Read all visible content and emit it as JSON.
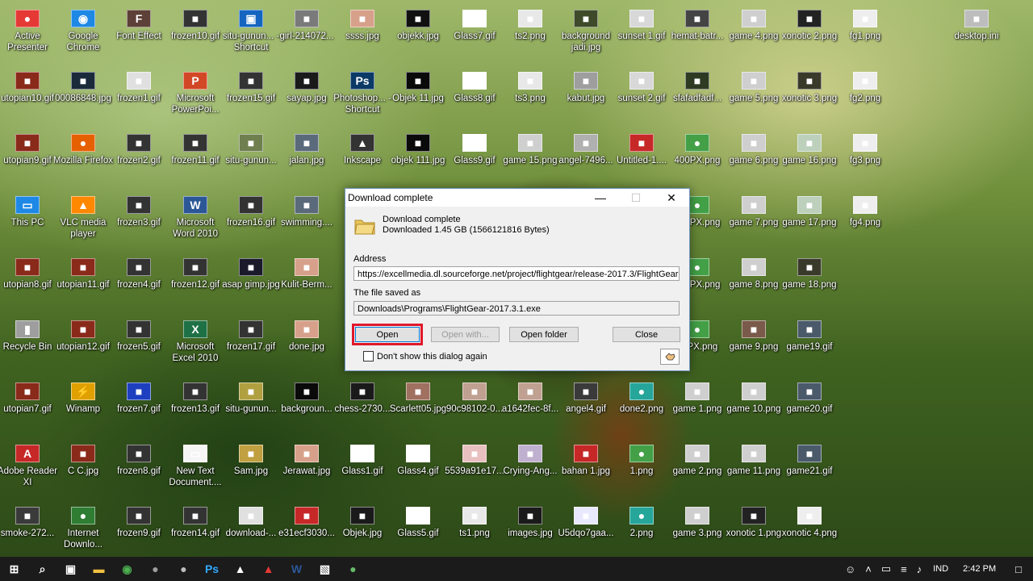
{
  "desktop_icons": [
    {
      "label": "Active Presenter",
      "glyph": "●",
      "color": "#e53935",
      "col": 0,
      "row": 0
    },
    {
      "label": "Google Chrome",
      "glyph": "◉",
      "color": "#1e88e5",
      "col": 1,
      "row": 0
    },
    {
      "label": "Font Effect",
      "glyph": "F",
      "color": "#5d4037",
      "col": 2,
      "row": 0
    },
    {
      "label": "frozen10.gif",
      "glyph": "■",
      "color": "#333333",
      "col": 3,
      "row": 0
    },
    {
      "label": "situ-gunun... - Shortcut",
      "glyph": "▣",
      "color": "#1565c0",
      "col": 4,
      "row": 0
    },
    {
      "label": "girl-214072...",
      "glyph": "■",
      "color": "#7a7a7a",
      "col": 5,
      "row": 0
    },
    {
      "label": "ssss.jpg",
      "glyph": "■",
      "color": "#d7a08a",
      "col": 6,
      "row": 0
    },
    {
      "label": "objekk.jpg",
      "glyph": "■",
      "color": "#111111",
      "col": 7,
      "row": 0
    },
    {
      "label": "Glass7.gif",
      "glyph": "■",
      "color": "#ffffff",
      "col": 8,
      "row": 0
    },
    {
      "label": "ts2.png",
      "glyph": "■",
      "color": "#e8e8e8",
      "col": 9,
      "row": 0
    },
    {
      "label": "background jadi.jpg",
      "glyph": "■",
      "color": "#3e4a2a",
      "col": 10,
      "row": 0
    },
    {
      "label": "sunset 1.gif",
      "glyph": "■",
      "color": "#d8d8d8",
      "col": 11,
      "row": 0
    },
    {
      "label": "hemat-batr...",
      "glyph": "■",
      "color": "#444444",
      "col": 12,
      "row": 0
    },
    {
      "label": "game 4.png",
      "glyph": "■",
      "color": "#cfcfcf",
      "col": 13,
      "row": 0
    },
    {
      "label": "xonotic 2.png",
      "glyph": "■",
      "color": "#222222",
      "col": 14,
      "row": 0
    },
    {
      "label": "fg1.png",
      "glyph": "■",
      "color": "#eeeeee",
      "col": 15,
      "row": 0
    },
    {
      "label": "desktop.ini",
      "glyph": "■",
      "color": "#bdbdbd",
      "col": 17,
      "row": 0
    },
    {
      "label": "utopian10.gif",
      "glyph": "■",
      "color": "#8a2a1a",
      "col": 0,
      "row": 1
    },
    {
      "label": "00086848.jpg",
      "glyph": "■",
      "color": "#1a2a3a",
      "col": 1,
      "row": 1
    },
    {
      "label": "frozen1.gif",
      "glyph": "■",
      "color": "#e0e0e0",
      "col": 2,
      "row": 1
    },
    {
      "label": "Microsoft PowerPoi...",
      "glyph": "P",
      "color": "#d24726",
      "col": 3,
      "row": 1
    },
    {
      "label": "frozen15.gif",
      "glyph": "■",
      "color": "#333333",
      "col": 4,
      "row": 1
    },
    {
      "label": "sayap.jpg",
      "glyph": "■",
      "color": "#1a1a1a",
      "col": 5,
      "row": 1
    },
    {
      "label": "Photoshop... - Shortcut",
      "glyph": "Ps",
      "color": "#0b3a66",
      "col": 6,
      "row": 1
    },
    {
      "label": "Objek 11.jpg",
      "glyph": "■",
      "color": "#0a0a0a",
      "col": 7,
      "row": 1
    },
    {
      "label": "Glass8.gif",
      "glyph": "■",
      "color": "#ffffff",
      "col": 8,
      "row": 1
    },
    {
      "label": "ts3.png",
      "glyph": "■",
      "color": "#e8e8e8",
      "col": 9,
      "row": 1
    },
    {
      "label": "kabut.jpg",
      "glyph": "■",
      "color": "#9e9e9e",
      "col": 10,
      "row": 1
    },
    {
      "label": "sunset 2.gif",
      "glyph": "■",
      "color": "#d8d8d8",
      "col": 11,
      "row": 1
    },
    {
      "label": "sfafadfadf...",
      "glyph": "■",
      "color": "#2e3b22",
      "col": 12,
      "row": 1
    },
    {
      "label": "game 5.png",
      "glyph": "■",
      "color": "#cfcfcf",
      "col": 13,
      "row": 1
    },
    {
      "label": "xonotic 3.png",
      "glyph": "■",
      "color": "#3a3a2a",
      "col": 14,
      "row": 1
    },
    {
      "label": "fg2.png",
      "glyph": "■",
      "color": "#eeeeee",
      "col": 15,
      "row": 1
    },
    {
      "label": "utopian9.gif",
      "glyph": "■",
      "color": "#8a2a1a",
      "col": 0,
      "row": 2
    },
    {
      "label": "Mozilla Firefox",
      "glyph": "●",
      "color": "#e66000",
      "col": 1,
      "row": 2
    },
    {
      "label": "frozen2.gif",
      "glyph": "■",
      "color": "#333333",
      "col": 2,
      "row": 2
    },
    {
      "label": "frozen11.gif",
      "glyph": "■",
      "color": "#333333",
      "col": 3,
      "row": 2
    },
    {
      "label": "situ-gunun...",
      "glyph": "■",
      "color": "#6f7f4f",
      "col": 4,
      "row": 2
    },
    {
      "label": "jalan.jpg",
      "glyph": "■",
      "color": "#5a6a7a",
      "col": 5,
      "row": 2
    },
    {
      "label": "Inkscape",
      "glyph": "▲",
      "color": "#333333",
      "col": 6,
      "row": 2
    },
    {
      "label": "objek 111.jpg",
      "glyph": "■",
      "color": "#0a0a0a",
      "col": 7,
      "row": 2
    },
    {
      "label": "Glass9.gif",
      "glyph": "■",
      "color": "#ffffff",
      "col": 8,
      "row": 2
    },
    {
      "label": "game 15.png",
      "glyph": "■",
      "color": "#cfcfcf",
      "col": 9,
      "row": 2
    },
    {
      "label": "angel-7496...",
      "glyph": "■",
      "color": "#b0b0b0",
      "col": 10,
      "row": 2
    },
    {
      "label": "Untitled-1....",
      "glyph": "■",
      "color": "#c62828",
      "col": 11,
      "row": 2
    },
    {
      "label": "400PX.png",
      "glyph": "●",
      "color": "#43a047",
      "col": 12,
      "row": 2
    },
    {
      "label": "game 6.png",
      "glyph": "■",
      "color": "#cfcfcf",
      "col": 13,
      "row": 2
    },
    {
      "label": "game 16.png",
      "glyph": "■",
      "color": "#bcd0bc",
      "col": 14,
      "row": 2
    },
    {
      "label": "fg3.png",
      "glyph": "■",
      "color": "#eeeeee",
      "col": 15,
      "row": 2
    },
    {
      "label": "This PC",
      "glyph": "▭",
      "color": "#1e88e5",
      "col": 0,
      "row": 3
    },
    {
      "label": "VLC media player",
      "glyph": "▲",
      "color": "#ff8800",
      "col": 1,
      "row": 3
    },
    {
      "label": "frozen3.gif",
      "glyph": "■",
      "color": "#333333",
      "col": 2,
      "row": 3
    },
    {
      "label": "Microsoft Word 2010",
      "glyph": "W",
      "color": "#2b5797",
      "col": 3,
      "row": 3
    },
    {
      "label": "frozen16.gif",
      "glyph": "■",
      "color": "#333333",
      "col": 4,
      "row": 3
    },
    {
      "label": "swimming....",
      "glyph": "■",
      "color": "#5a6a7a",
      "col": 5,
      "row": 3
    },
    {
      "label": "200PX.png",
      "glyph": "●",
      "color": "#43a047",
      "col": 12,
      "row": 3
    },
    {
      "label": "game 7.png",
      "glyph": "■",
      "color": "#cfcfcf",
      "col": 13,
      "row": 3
    },
    {
      "label": "game 17.png",
      "glyph": "■",
      "color": "#bcd0bc",
      "col": 14,
      "row": 3
    },
    {
      "label": "fg4.png",
      "glyph": "■",
      "color": "#eeeeee",
      "col": 15,
      "row": 3
    },
    {
      "label": "utopian8.gif",
      "glyph": "■",
      "color": "#8a2a1a",
      "col": 0,
      "row": 4
    },
    {
      "label": "utopian11.gif",
      "glyph": "■",
      "color": "#8a2a1a",
      "col": 1,
      "row": 4
    },
    {
      "label": "frozen4.gif",
      "glyph": "■",
      "color": "#333333",
      "col": 2,
      "row": 4
    },
    {
      "label": "frozen12.gif",
      "glyph": "■",
      "color": "#333333",
      "col": 3,
      "row": 4
    },
    {
      "label": "asap gimp.jpg",
      "glyph": "■",
      "color": "#1a1a2a",
      "col": 4,
      "row": 4
    },
    {
      "label": "Kulit-Berm...",
      "glyph": "■",
      "color": "#d7a08a",
      "col": 5,
      "row": 4
    },
    {
      "label": "144PX.png",
      "glyph": "●",
      "color": "#43a047",
      "col": 12,
      "row": 4
    },
    {
      "label": "game 8.png",
      "glyph": "■",
      "color": "#cfcfcf",
      "col": 13,
      "row": 4
    },
    {
      "label": "game 18.png",
      "glyph": "■",
      "color": "#3a3a2a",
      "col": 14,
      "row": 4
    },
    {
      "label": "Recycle Bin",
      "glyph": "▮",
      "color": "#9e9e9e",
      "col": 0,
      "row": 5
    },
    {
      "label": "utopian12.gif",
      "glyph": "■",
      "color": "#8a2a1a",
      "col": 1,
      "row": 5
    },
    {
      "label": "frozen5.gif",
      "glyph": "■",
      "color": "#333333",
      "col": 2,
      "row": 5
    },
    {
      "label": "Microsoft Excel 2010",
      "glyph": "X",
      "color": "#1e7145",
      "col": 3,
      "row": 5
    },
    {
      "label": "frozen17.gif",
      "glyph": "■",
      "color": "#333333",
      "col": 4,
      "row": 5
    },
    {
      "label": "done.jpg",
      "glyph": "■",
      "color": "#d7a08a",
      "col": 5,
      "row": 5
    },
    {
      "label": "72PX.png",
      "glyph": "●",
      "color": "#43a047",
      "col": 12,
      "row": 5
    },
    {
      "label": "game 9.png",
      "glyph": "■",
      "color": "#7a5a4a",
      "col": 13,
      "row": 5
    },
    {
      "label": "game19.gif",
      "glyph": "■",
      "color": "#4a5a6a",
      "col": 14,
      "row": 5
    },
    {
      "label": "utopian7.gif",
      "glyph": "■",
      "color": "#8a2a1a",
      "col": 0,
      "row": 6
    },
    {
      "label": "Winamp",
      "glyph": "⚡",
      "color": "#e0a000",
      "col": 1,
      "row": 6
    },
    {
      "label": "frozen7.gif",
      "glyph": "■",
      "color": "#1e40c0",
      "col": 2,
      "row": 6
    },
    {
      "label": "frozen13.gif",
      "glyph": "■",
      "color": "#333333",
      "col": 3,
      "row": 6
    },
    {
      "label": "situ-gunun...",
      "glyph": "■",
      "color": "#b0a040",
      "col": 4,
      "row": 6
    },
    {
      "label": "backgroun...",
      "glyph": "■",
      "color": "#0a0a0a",
      "col": 5,
      "row": 6
    },
    {
      "label": "chess-2730...",
      "glyph": "■",
      "color": "#1a1a1a",
      "col": 6,
      "row": 6
    },
    {
      "label": "Scarlett05.jpg",
      "glyph": "■",
      "color": "#a07060",
      "col": 7,
      "row": 6
    },
    {
      "label": "90c98102-0...",
      "glyph": "■",
      "color": "#c0a090",
      "col": 8,
      "row": 6
    },
    {
      "label": "a1642fec-8f...",
      "glyph": "■",
      "color": "#c0a090",
      "col": 9,
      "row": 6
    },
    {
      "label": "angel4.gif",
      "glyph": "■",
      "color": "#3a3a3a",
      "col": 10,
      "row": 6
    },
    {
      "label": "done2.png",
      "glyph": "●",
      "color": "#26a69a",
      "col": 11,
      "row": 6
    },
    {
      "label": "game 1.png",
      "glyph": "■",
      "color": "#cfcfcf",
      "col": 12,
      "row": 6
    },
    {
      "label": "game 10.png",
      "glyph": "■",
      "color": "#cfcfcf",
      "col": 13,
      "row": 6
    },
    {
      "label": "game20.gif",
      "glyph": "■",
      "color": "#4a5a6a",
      "col": 14,
      "row": 6
    },
    {
      "label": "Adobe Reader XI",
      "glyph": "A",
      "color": "#c62828",
      "col": 0,
      "row": 7
    },
    {
      "label": "C C.jpg",
      "glyph": "■",
      "color": "#8a2a1a",
      "col": 1,
      "row": 7
    },
    {
      "label": "frozen8.gif",
      "glyph": "■",
      "color": "#333333",
      "col": 2,
      "row": 7
    },
    {
      "label": "New Text Document....",
      "glyph": "▭",
      "color": "#f5f5f5",
      "col": 3,
      "row": 7
    },
    {
      "label": "Sam.jpg",
      "glyph": "■",
      "color": "#c0a040",
      "col": 4,
      "row": 7
    },
    {
      "label": "Jerawat.jpg",
      "glyph": "■",
      "color": "#d7a08a",
      "col": 5,
      "row": 7
    },
    {
      "label": "Glass1.gif",
      "glyph": "■",
      "color": "#ffffff",
      "col": 6,
      "row": 7
    },
    {
      "label": "Glass4.gif",
      "glyph": "■",
      "color": "#ffffff",
      "col": 7,
      "row": 7
    },
    {
      "label": "5539a91e17...",
      "glyph": "■",
      "color": "#e8c0c0",
      "col": 8,
      "row": 7
    },
    {
      "label": "Crying-Ang...",
      "glyph": "■",
      "color": "#c0b0d0",
      "col": 9,
      "row": 7
    },
    {
      "label": "bahan 1.jpg",
      "glyph": "■",
      "color": "#c62828",
      "col": 10,
      "row": 7
    },
    {
      "label": "1.png",
      "glyph": "●",
      "color": "#43a047",
      "col": 11,
      "row": 7
    },
    {
      "label": "game 2.png",
      "glyph": "■",
      "color": "#cfcfcf",
      "col": 12,
      "row": 7
    },
    {
      "label": "game 11.png",
      "glyph": "■",
      "color": "#cfcfcf",
      "col": 13,
      "row": 7
    },
    {
      "label": "game21.gif",
      "glyph": "■",
      "color": "#4a5a6a",
      "col": 14,
      "row": 7
    },
    {
      "label": "smoke-272...",
      "glyph": "■",
      "color": "#3a3a3a",
      "col": 0,
      "row": 8
    },
    {
      "label": "Internet Downlo...",
      "glyph": "●",
      "color": "#2e7d32",
      "col": 1,
      "row": 8
    },
    {
      "label": "frozen9.gif",
      "glyph": "■",
      "color": "#333333",
      "col": 2,
      "row": 8
    },
    {
      "label": "frozen14.gif",
      "glyph": "■",
      "color": "#333333",
      "col": 3,
      "row": 8
    },
    {
      "label": "download-...",
      "glyph": "■",
      "color": "#e0e0e0",
      "col": 4,
      "row": 8
    },
    {
      "label": "e31ecf3030...",
      "glyph": "■",
      "color": "#c62828",
      "col": 5,
      "row": 8
    },
    {
      "label": "Objek.jpg",
      "glyph": "■",
      "color": "#1a1a1a",
      "col": 6,
      "row": 8
    },
    {
      "label": "Glass5.gif",
      "glyph": "■",
      "color": "#ffffff",
      "col": 7,
      "row": 8
    },
    {
      "label": "ts1.png",
      "glyph": "■",
      "color": "#e8e8e8",
      "col": 8,
      "row": 8
    },
    {
      "label": "images.jpg",
      "glyph": "■",
      "color": "#1a1a1a",
      "col": 9,
      "row": 8
    },
    {
      "label": "U5dqo7gaa...",
      "glyph": "■",
      "color": "#e8e8ff",
      "col": 10,
      "row": 8
    },
    {
      "label": "2.png",
      "glyph": "●",
      "color": "#26a69a",
      "col": 11,
      "row": 8
    },
    {
      "label": "game 3.png",
      "glyph": "■",
      "color": "#cfcfcf",
      "col": 12,
      "row": 8
    },
    {
      "label": "xonotic 1.png",
      "glyph": "■",
      "color": "#222222",
      "col": 13,
      "row": 8
    },
    {
      "label": "xonotic 4.png",
      "glyph": "■",
      "color": "#eeeeee",
      "col": 14,
      "row": 8
    }
  ],
  "dialog": {
    "title": "Download complete",
    "minimize_glyph": "—",
    "maximize_glyph": "☐",
    "close_glyph": "✕",
    "heading": "Download complete",
    "size_text": "Downloaded 1.45  GB (1566121816 Bytes)",
    "address_label": "Address",
    "address_value": "https://excellmedia.dl.sourceforge.net/project/flightgear/release-2017.3/FlightGear-2017.3.1.exe",
    "saved_label": "The file saved as",
    "saved_value": "Downloads\\Programs\\FlightGear-2017.3.1.exe",
    "open_label": "Open",
    "open_with_label": "Open with...",
    "open_folder_label": "Open folder",
    "close_label": "Close",
    "dont_show_label": "Don't show this dialog again",
    "dont_show_checked": false
  },
  "taskbar": {
    "items": [
      {
        "name": "start-button",
        "glyph": "⊞",
        "color": "#ffffff"
      },
      {
        "name": "search-button",
        "glyph": "⌕",
        "color": "#ffffff"
      },
      {
        "name": "task-view-button",
        "glyph": "▣",
        "color": "#ffffff"
      },
      {
        "name": "file-explorer-button",
        "glyph": "▬",
        "color": "#f0c040"
      },
      {
        "name": "chrome-button",
        "glyph": "◉",
        "color": "#4caf50"
      },
      {
        "name": "app-button-1",
        "glyph": "●",
        "color": "#9e9e9e"
      },
      {
        "name": "app-button-2",
        "glyph": "●",
        "color": "#bdbdbd"
      },
      {
        "name": "photoshop-button",
        "glyph": "Ps",
        "color": "#31a8ff"
      },
      {
        "name": "inkscape-button",
        "glyph": "▲",
        "color": "#ffffff"
      },
      {
        "name": "app-button-3",
        "glyph": "▲",
        "color": "#e53935"
      },
      {
        "name": "word-button",
        "glyph": "W",
        "color": "#2b5797"
      },
      {
        "name": "photos-button",
        "glyph": "▧",
        "color": "#ffffff"
      },
      {
        "name": "internet-download-manager-button",
        "glyph": "●",
        "color": "#66bb6a"
      }
    ],
    "tray": {
      "people_glyph": "☺",
      "chevron_glyph": "˄",
      "battery_glyph": "▭",
      "wifi_glyph": "≡",
      "volume_glyph": "♪",
      "language": "IND",
      "time": "2:42 PM",
      "notification_glyph": "□"
    }
  }
}
